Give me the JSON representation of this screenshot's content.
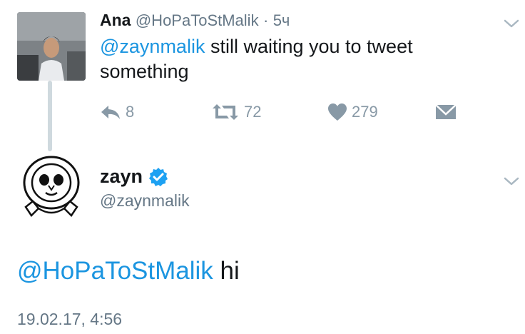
{
  "reply_tweet": {
    "name": "Ana",
    "handle": "@HoPaToStMalik",
    "separator": "·",
    "time": "5ч",
    "mention": "@zaynmalik",
    "text": " still waiting you to tweet something",
    "actions": {
      "reply_count": "8",
      "retweet_count": "72",
      "like_count": "279"
    }
  },
  "main_tweet": {
    "name": "zayn",
    "handle": "@zaynmalik",
    "mention": "@HoPaToStMalik",
    "text": " hi",
    "timestamp": "19.02.17, 4:56"
  },
  "colors": {
    "link": "#1b95e0",
    "muted": "#8899a6",
    "verified": "#1da1f2",
    "thread_line": "#cfd9de"
  },
  "icons": {
    "reply": "reply-arrow-icon",
    "retweet": "retweet-icon",
    "like": "heart-icon",
    "dm": "envelope-icon",
    "more": "chevron-down-icon",
    "verified": "verified-badge-icon"
  }
}
